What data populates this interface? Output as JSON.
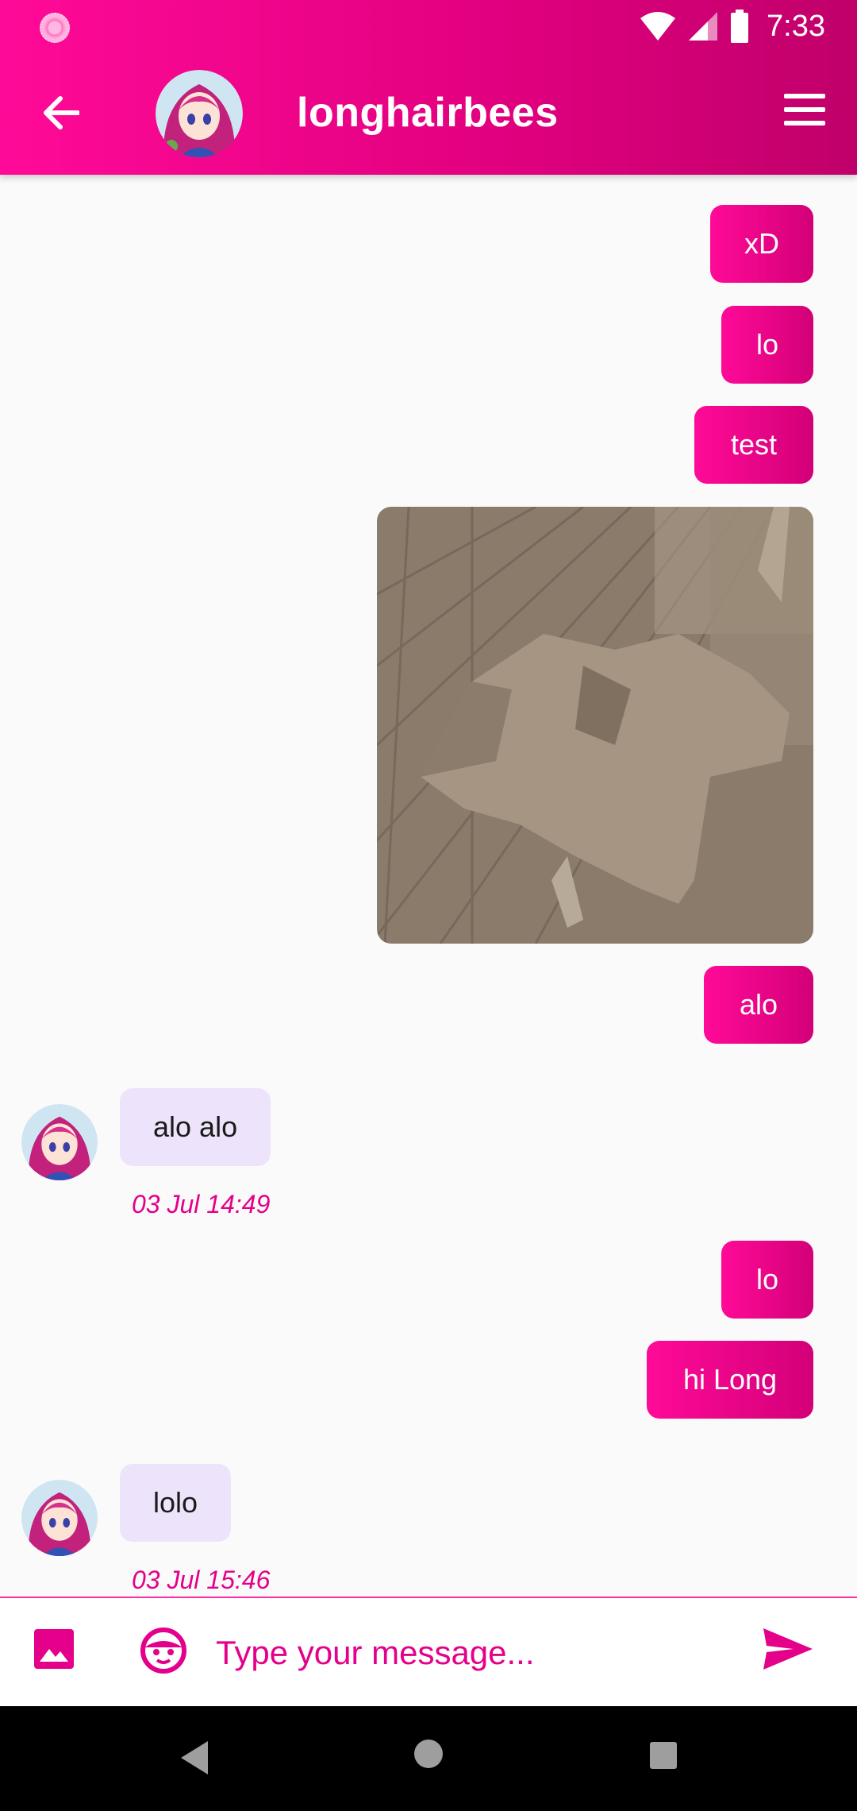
{
  "status_bar": {
    "time": "7:33",
    "icons": [
      "notification-dot-icon",
      "wifi-icon",
      "cell-signal-icon",
      "battery-icon"
    ]
  },
  "header": {
    "title": "longhairbees",
    "back_icon": "arrow-back-icon",
    "menu_icon": "hamburger-menu-icon"
  },
  "messages": [
    {
      "direction": "out",
      "type": "text",
      "text": "xD"
    },
    {
      "direction": "out",
      "type": "text",
      "text": "lo"
    },
    {
      "direction": "out",
      "type": "text",
      "text": "test"
    },
    {
      "direction": "out",
      "type": "image"
    },
    {
      "direction": "out",
      "type": "text",
      "text": "alo"
    },
    {
      "direction": "in",
      "type": "text",
      "text": "alo alo",
      "timestamp": "03 Jul 14:49"
    },
    {
      "direction": "out",
      "type": "text",
      "text": "lo"
    },
    {
      "direction": "out",
      "type": "text",
      "text": "hi Long"
    },
    {
      "direction": "in",
      "type": "text",
      "text": "lolo",
      "timestamp": "03 Jul 15:46"
    }
  ],
  "composer": {
    "placeholder": "Type your message...",
    "value": "",
    "image_icon": "image-icon",
    "emoji_icon": "emoji-icon",
    "send_icon": "send-icon"
  },
  "colors": {
    "accent": "#ff0a98",
    "accent_dark": "#d30078",
    "incoming_bubble": "#ede4fb",
    "timestamp": "#e4008a",
    "background": "#fafafa"
  }
}
